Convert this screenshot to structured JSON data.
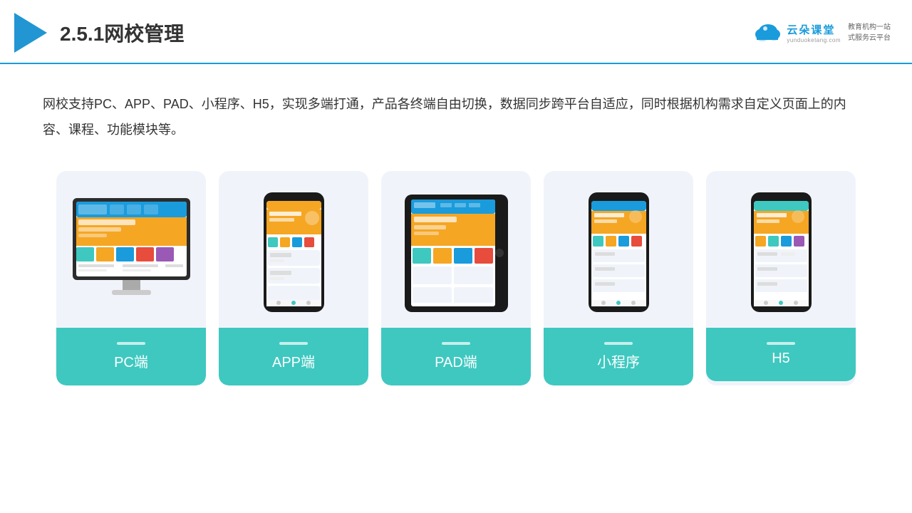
{
  "header": {
    "title": "2.5.1网校管理",
    "brand_cn": "云朵课堂",
    "brand_en": "yunduoketang.com",
    "tagline_line1": "教育机构一站",
    "tagline_line2": "式服务云平台"
  },
  "description": "网校支持PC、APP、PAD、小程序、H5，实现多端打通，产品各终端自由切换，数据同步跨平台自适应，同时根据机构需求自定义页面上的内容、课程、功能模块等。",
  "cards": [
    {
      "id": "pc",
      "label": "PC端",
      "type": "pc"
    },
    {
      "id": "app",
      "label": "APP端",
      "type": "phone"
    },
    {
      "id": "pad",
      "label": "PAD端",
      "type": "tablet"
    },
    {
      "id": "miniapp",
      "label": "小程序",
      "type": "phone"
    },
    {
      "id": "h5",
      "label": "H5",
      "type": "phone"
    }
  ],
  "accent_color": "#3ec8c0"
}
